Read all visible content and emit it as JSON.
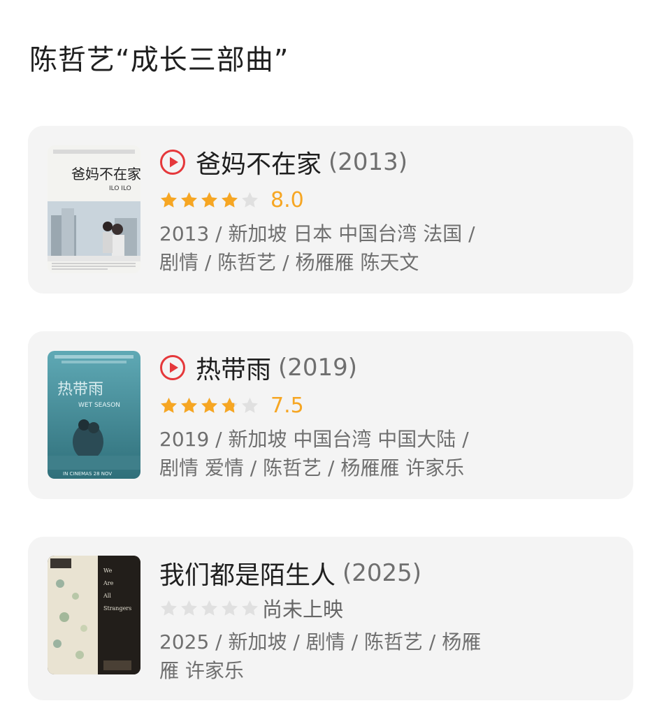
{
  "page": {
    "title": "陈哲艺“成长三部曲”"
  },
  "colors": {
    "card_bg": "#f4f4f4",
    "star_filled": "#f6a623",
    "star_empty": "#e0e0e0",
    "play_icon": "#e5383b",
    "meta_text": "#6f6f6f"
  },
  "movies": [
    {
      "title": "爸妈不在家",
      "year": "(2013)",
      "has_play_icon": true,
      "rating": 8.0,
      "rating_text": "8.0",
      "meta_lines": [
        "2013 / 新加坡 日本 中国台湾 法国 /",
        "剧情 / 陈哲艺 / 杨雁雁 陈天文"
      ],
      "poster": {
        "title_text": "爸妈不在家",
        "subtitle_text": "ILO ILO"
      }
    },
    {
      "title": "热带雨",
      "year": "(2019)",
      "has_play_icon": true,
      "rating": 7.5,
      "rating_text": "7.5",
      "meta_lines": [
        "2019 / 新加坡 中国台湾 中国大陆 /",
        "剧情 爱情 / 陈哲艺 / 杨雁雁 许家乐"
      ],
      "poster": {
        "title_text": "热带雨",
        "subtitle_text": "WET SEASON",
        "footer_text": "IN CINEMAS 28 NOV"
      }
    },
    {
      "title": "我们都是陌生人",
      "year": "(2025)",
      "has_play_icon": false,
      "rating": null,
      "rating_text": "尚未上映",
      "meta_lines": [
        "2025 / 新加坡 / 剧情 / 陈哲艺 / 杨雁",
        "雁 许家乐"
      ],
      "poster": {
        "title_lines": [
          "We",
          "Are",
          "All",
          "Strangers"
        ]
      }
    }
  ]
}
